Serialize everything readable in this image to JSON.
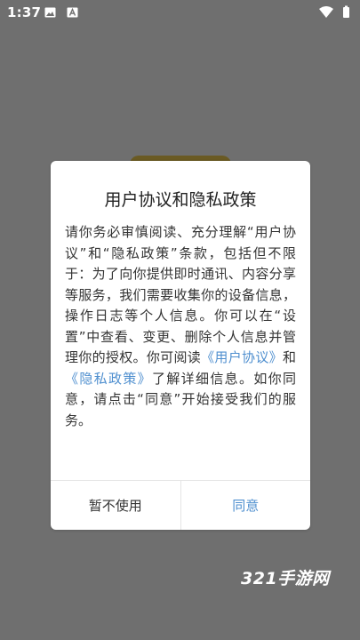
{
  "status_bar": {
    "time": "1:37"
  },
  "dialog": {
    "title": "用户协议和隐私政策",
    "body": {
      "text_before_links": "请你务必审慎阅读、充分理解“用户协议”和“隐私政策”条款，包括但不限于：为了向你提供即时通讯、内容分享等服务，我们需要收集你的设备信息，操作日志等个人信息。你可以在“设置”中查看、变更、删除个人信息并管理你的授权。你可阅读",
      "link_user_agreement": "《用户协议》",
      "and_text": "和",
      "link_privacy_policy": "《隐私政策》",
      "text_after_links": "了解详细信息。如你同意，请点击“同意”开始接受我们的服务。"
    },
    "buttons": {
      "cancel": "暂不使用",
      "agree": "同意"
    }
  },
  "watermark": "321手游网",
  "colors": {
    "overlay": "#6f6f6f",
    "link": "#4f8fcf",
    "dialog_bg": "#ffffff"
  }
}
